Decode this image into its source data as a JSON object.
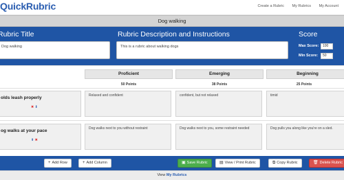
{
  "brand": {
    "logo_text": "QuickRubric"
  },
  "nav": {
    "links": [
      {
        "label": "Create a Rubric"
      },
      {
        "label": "My Rubrics"
      },
      {
        "label": "My Account"
      }
    ]
  },
  "rubric": {
    "name": "Dog walking"
  },
  "header": {
    "title_heading": "Rubric Title",
    "title_value": "Dog walking",
    "description_heading": "Rubric Description and Instructions",
    "description_value": "This is a rubric about walking dogs",
    "score_heading": "Score",
    "max_label": "Max Score:",
    "max_value": "100",
    "min_label": "Min Score:",
    "min_value": "50"
  },
  "columns": [
    {
      "label": "Proficient",
      "points": "50 Points"
    },
    {
      "label": "Emerging",
      "points": "38 Points"
    },
    {
      "label": "Beginning",
      "points": "25 Points"
    }
  ],
  "rows": [
    {
      "label": "olds leash properly",
      "controls": {
        "delete": "✖",
        "down": "⬇",
        "up": ""
      },
      "cells": [
        "Relaxed and confident",
        "confident, but not relaxed",
        "timid"
      ]
    },
    {
      "label": "og walks at your pace",
      "controls": {
        "delete": "✖",
        "down": "",
        "up": "⬆"
      },
      "cells": [
        "Dog walks next to you without restraint",
        "Dog walks next to you, some restraint needed",
        "Dog pulls you along like you're on a sled."
      ]
    }
  ],
  "toolbar": {
    "add_row": "Add Row",
    "add_column": "Add Column",
    "save": "Save Rubric",
    "view_print": "View / Print Rubric",
    "copy": "Copy Rubric",
    "delete": "Delete Rubric"
  },
  "icons": {
    "plus": "+",
    "save": "▣",
    "print": "▤",
    "copy": "⧉",
    "trash": "🗑"
  },
  "footer": {
    "prefix": "View",
    "link": "My Rubrics"
  },
  "colors": {
    "primary": "#1f55a5",
    "success": "#4cae4c",
    "danger": "#d9534f"
  }
}
